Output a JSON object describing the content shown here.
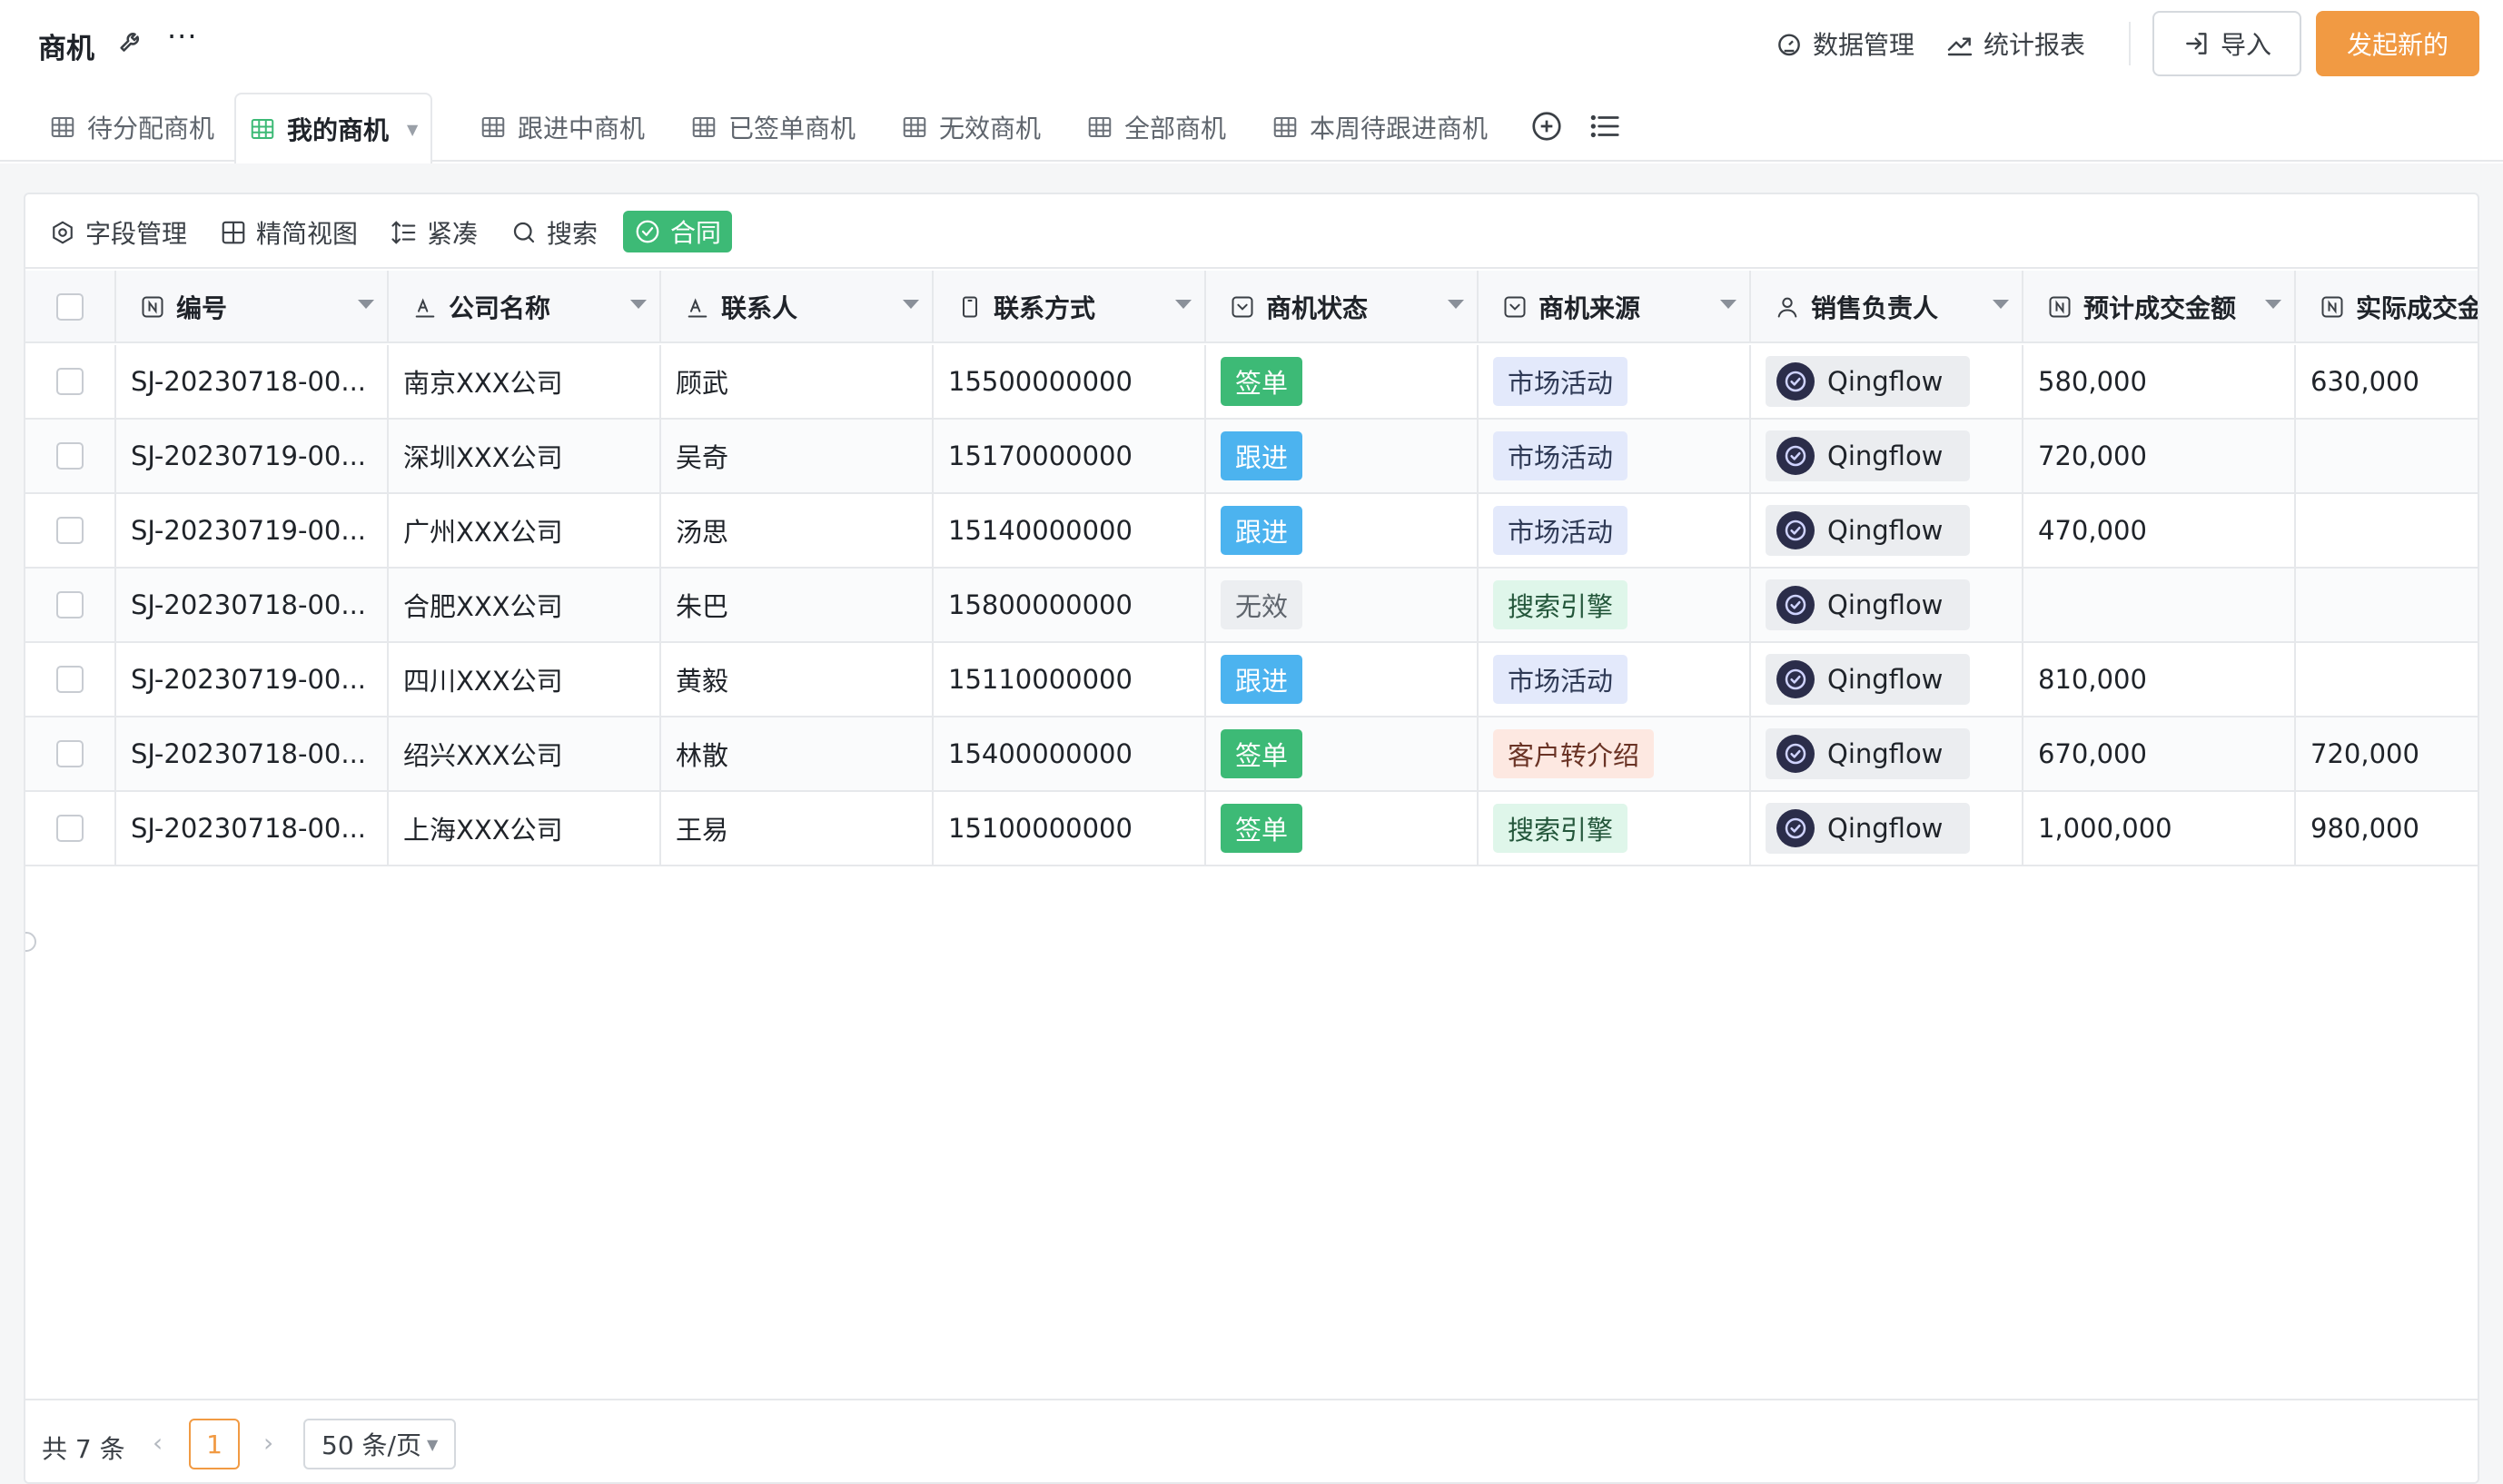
{
  "app": {
    "title": "商机"
  },
  "header": {
    "data_manage": "数据管理",
    "reports": "统计报表",
    "import": "导入",
    "new": "发起新的"
  },
  "tabs": [
    {
      "label": "待分配商机"
    },
    {
      "label": "我的商机",
      "active": true
    },
    {
      "label": "跟进中商机"
    },
    {
      "label": "已签单商机"
    },
    {
      "label": "无效商机"
    },
    {
      "label": "全部商机"
    },
    {
      "label": "本周待跟进商机"
    }
  ],
  "toolbar": {
    "fields": "字段管理",
    "compact_view": "精简视图",
    "density": "紧凑",
    "search": "搜索",
    "contract": "合同"
  },
  "table": {
    "columns": [
      "编号",
      "公司名称",
      "联系人",
      "联系方式",
      "商机状态",
      "商机来源",
      "销售负责人",
      "预计成交金额",
      "实际成交金"
    ],
    "rows": [
      {
        "id": "SJ-20230718-00...",
        "company": "南京XXX公司",
        "contact": "顾武",
        "phone": "15500000000",
        "status": "签单",
        "source": "市场活动",
        "owner": "Qingflow",
        "expected": "580,000",
        "actual": "630,000"
      },
      {
        "id": "SJ-20230719-00...",
        "company": "深圳XXX公司",
        "contact": "吴奇",
        "phone": "15170000000",
        "status": "跟进",
        "source": "市场活动",
        "owner": "Qingflow",
        "expected": "720,000",
        "actual": ""
      },
      {
        "id": "SJ-20230719-00...",
        "company": "广州XXX公司",
        "contact": "汤思",
        "phone": "15140000000",
        "status": "跟进",
        "source": "市场活动",
        "owner": "Qingflow",
        "expected": "470,000",
        "actual": ""
      },
      {
        "id": "SJ-20230718-00...",
        "company": "合肥XXX公司",
        "contact": "朱巴",
        "phone": "15800000000",
        "status": "无效",
        "source": "搜索引擎",
        "owner": "Qingflow",
        "expected": "",
        "actual": ""
      },
      {
        "id": "SJ-20230719-00...",
        "company": "四川XXX公司",
        "contact": "黄毅",
        "phone": "15110000000",
        "status": "跟进",
        "source": "市场活动",
        "owner": "Qingflow",
        "expected": "810,000",
        "actual": ""
      },
      {
        "id": "SJ-20230718-00...",
        "company": "绍兴XXX公司",
        "contact": "林散",
        "phone": "15400000000",
        "status": "签单",
        "source": "客户转介绍",
        "owner": "Qingflow",
        "expected": "670,000",
        "actual": "720,000"
      },
      {
        "id": "SJ-20230718-00...",
        "company": "上海XXX公司",
        "contact": "王易",
        "phone": "15100000000",
        "status": "签单",
        "source": "搜索引擎",
        "owner": "Qingflow",
        "expected": "1,000,000",
        "actual": "980,000"
      }
    ]
  },
  "status_colors": {
    "签单": {
      "bg": "#3dba76",
      "fg": "#ffffff"
    },
    "跟进": {
      "bg": "#4cb3ef",
      "fg": "#ffffff"
    },
    "无效": {
      "bg": "#eceef1",
      "fg": "#5f656d"
    }
  },
  "source_colors": {
    "市场活动": {
      "bg": "#e3e9fb",
      "fg": "#2f3a56"
    },
    "搜索引擎": {
      "bg": "#dff6ea",
      "fg": "#23563a"
    },
    "客户转介绍": {
      "bg": "#fde8e1",
      "fg": "#6a3325"
    }
  },
  "pagination": {
    "total": "共 7 条",
    "prev": "‹",
    "current": "1",
    "next": "›",
    "page_size": "50 条/页"
  },
  "icons": {
    "wrench": "wrench-icon",
    "more": "more-icon",
    "data_manage": "dashboard-icon",
    "reports": "trend-icon",
    "import": "import-icon",
    "tab": "table-grid-icon",
    "add_tab": "plus-circle-icon",
    "tab_list": "list-icon"
  }
}
